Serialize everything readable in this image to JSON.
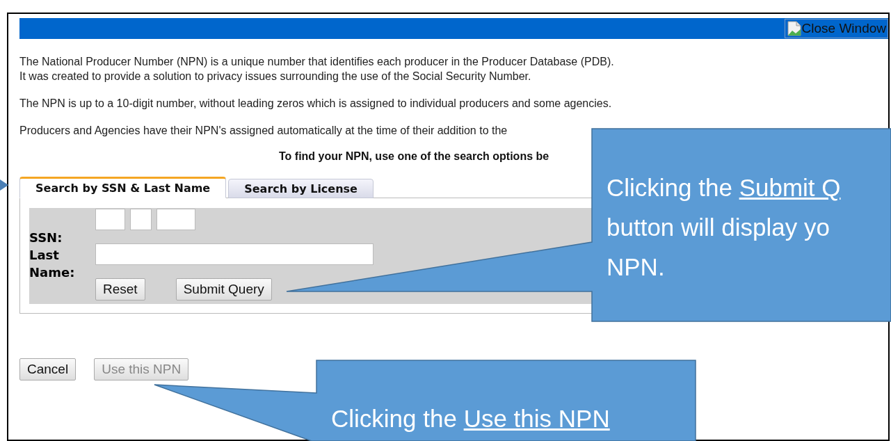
{
  "title_bar": {
    "close_button": "Close Window"
  },
  "paragraphs": [
    [
      "The National Producer Number (NPN) is a unique number that identifies each producer in the Producer Database (PDB).",
      "It was created to provide a solution to privacy issues surrounding the use of the Social Security Number."
    ],
    [
      "The NPN is up to a 10-digit number, without leading zeros which is assigned to individual producers and some agencies."
    ],
    [
      "Producers and Agencies have their NPN's assigned automatically at the time of their addition to the"
    ]
  ],
  "instruction": "To find your NPN, use one of the search options be",
  "tabs": [
    {
      "label": "Search by SSN & Last Name",
      "selected": true
    },
    {
      "label": "Search by License",
      "selected": false
    }
  ],
  "form": {
    "ssn_label": "SSN:",
    "last_name_label": "Last Name:",
    "buttons": [
      "Reset",
      "Submit Query"
    ]
  },
  "footer_buttons": [
    {
      "label": "Cancel",
      "disabled": false
    },
    {
      "label": "Use this NPN",
      "disabled": true
    }
  ],
  "callouts": [
    {
      "lines": [
        {
          "text": "Clicking the ",
          "underlined": "Submit Q"
        },
        {
          "text": "button will display yo"
        },
        {
          "text": "NPN."
        }
      ]
    },
    {
      "lines": [
        {
          "text": "Clicking the ",
          "underlined": "Use this NPN"
        }
      ]
    }
  ]
}
